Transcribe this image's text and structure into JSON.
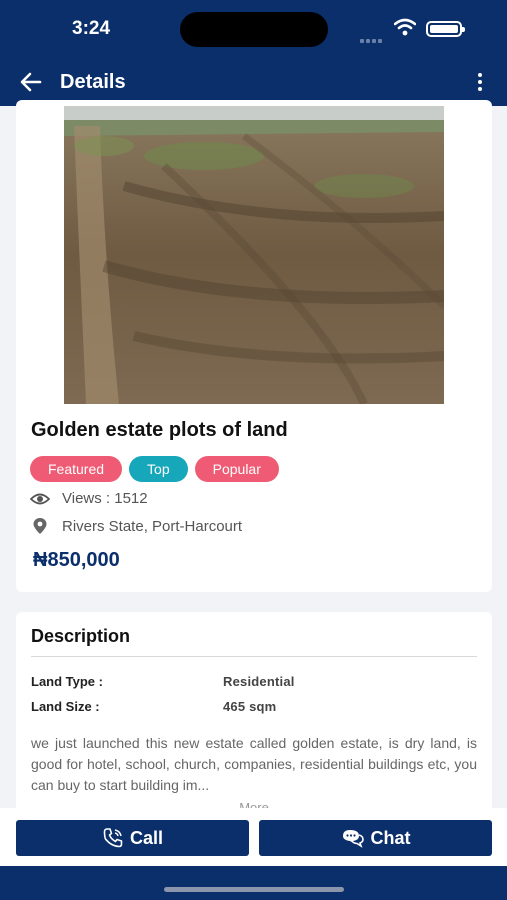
{
  "status_bar": {
    "time": "3:24"
  },
  "app_bar": {
    "title": "Details"
  },
  "listing": {
    "title": "Golden estate plots of land",
    "tags": [
      "Featured",
      "Top",
      "Popular"
    ],
    "views": "Views : 1512",
    "location": "Rivers State, Port-Harcourt",
    "price": "₦850,000"
  },
  "description": {
    "heading": "Description",
    "specs": [
      {
        "label": "Land Type :",
        "value": "Residential"
      },
      {
        "label": "Land Size :",
        "value": "465 sqm"
      }
    ],
    "text": "we just launched this new estate called golden estate, is dry land, is good for hotel, school, church, companies, residential buildings etc, you can buy to start building im...",
    "more_label": "More"
  },
  "actions": {
    "call_label": "Call",
    "chat_label": "Chat"
  },
  "colors": {
    "primary": "#0b2f6b",
    "tag_pink": "#ef5b74",
    "tag_teal": "#17a7ba"
  }
}
